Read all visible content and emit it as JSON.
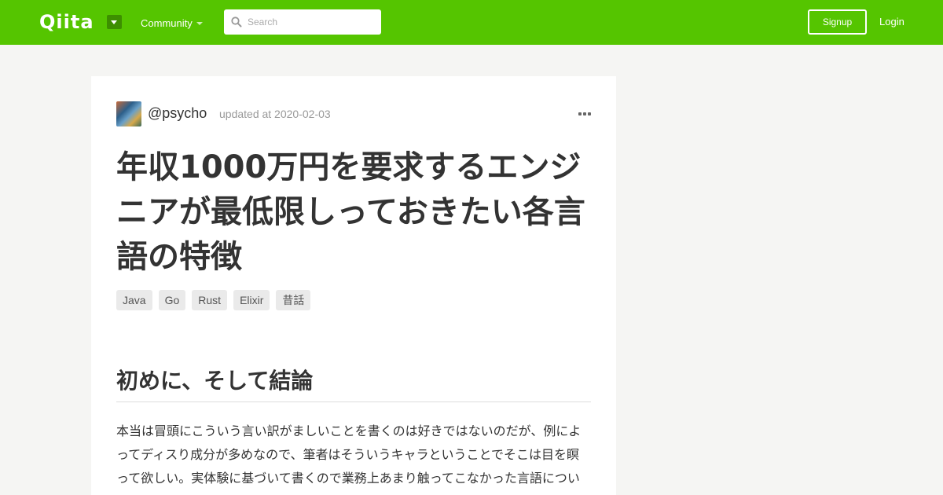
{
  "header": {
    "logo": "Qiita",
    "community_label": "Community",
    "search_placeholder": "Search",
    "signup_label": "Signup",
    "login_label": "Login"
  },
  "article": {
    "author": "@psycho",
    "updated": "updated at 2020-02-03",
    "title": "年収1000万円を要求するエンジニアが最低限しっておきたい各言語の特徴",
    "tags": [
      "Java",
      "Go",
      "Rust",
      "Elixir",
      "昔話"
    ],
    "section_heading": "初めに、そして結論",
    "body": "本当は冒頭にこういう言い訳がましいことを書くのは好きではないのだが、例によってディスり成分が多めなので、筆者はそういうキャラということでそこは目を瞑って欲しい。実体験に基づいて書くので業務上あまり触ってこなかった言語につい"
  },
  "colors": {
    "brand": "#55c500",
    "background": "#f5f5f3"
  },
  "icons": {
    "search": "search-icon",
    "more": "more-icon",
    "dropdown": "chevron-down-icon"
  }
}
